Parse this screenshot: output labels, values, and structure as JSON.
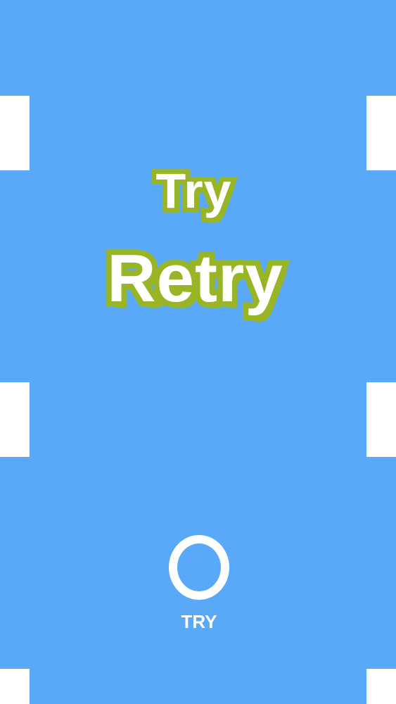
{
  "game": {
    "title_line1": "Try",
    "title_line2": "Retry"
  },
  "controls": {
    "try_label": "TRY",
    "try_icon": "ring-icon"
  },
  "colors": {
    "background": "#5aa8f8",
    "walls": "#ffffff",
    "logo_outline": "#98b526",
    "logo_fill": "#ffffff"
  }
}
